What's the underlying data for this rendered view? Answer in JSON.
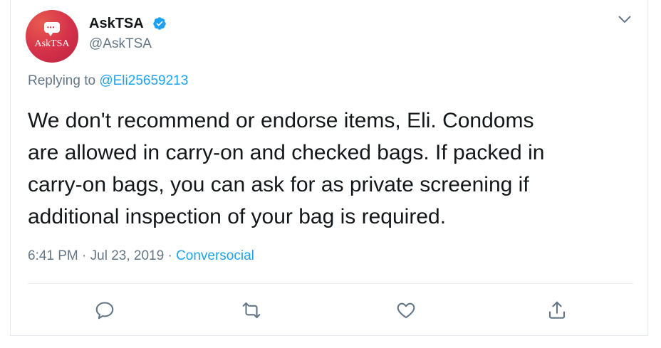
{
  "author": {
    "name": "AskTSA",
    "handle": "@AskTSA",
    "avatar_text": "AskTSA",
    "verified": true
  },
  "reply": {
    "prefix": "Replying to",
    "mention": "@Eli25659213"
  },
  "tweet": {
    "lines": [
      "We don't recommend or endorse items, Eli. Condoms",
      "are allowed in carry-on and checked bags. If packed in",
      "carry-on bags, you can ask for as private screening if",
      "additional inspection of your bag is required."
    ]
  },
  "meta": {
    "timestamp": "6:41 PM · Jul 23, 2019 · ",
    "source": "Conversocial"
  },
  "actions": {
    "reply_icon": "reply-icon",
    "retweet_icon": "retweet-icon",
    "like_icon": "heart-icon",
    "share_icon": "share-icon"
  },
  "colors": {
    "accent": "#1da1f2",
    "secondary_text": "#657786",
    "avatar": "#d4304a"
  }
}
